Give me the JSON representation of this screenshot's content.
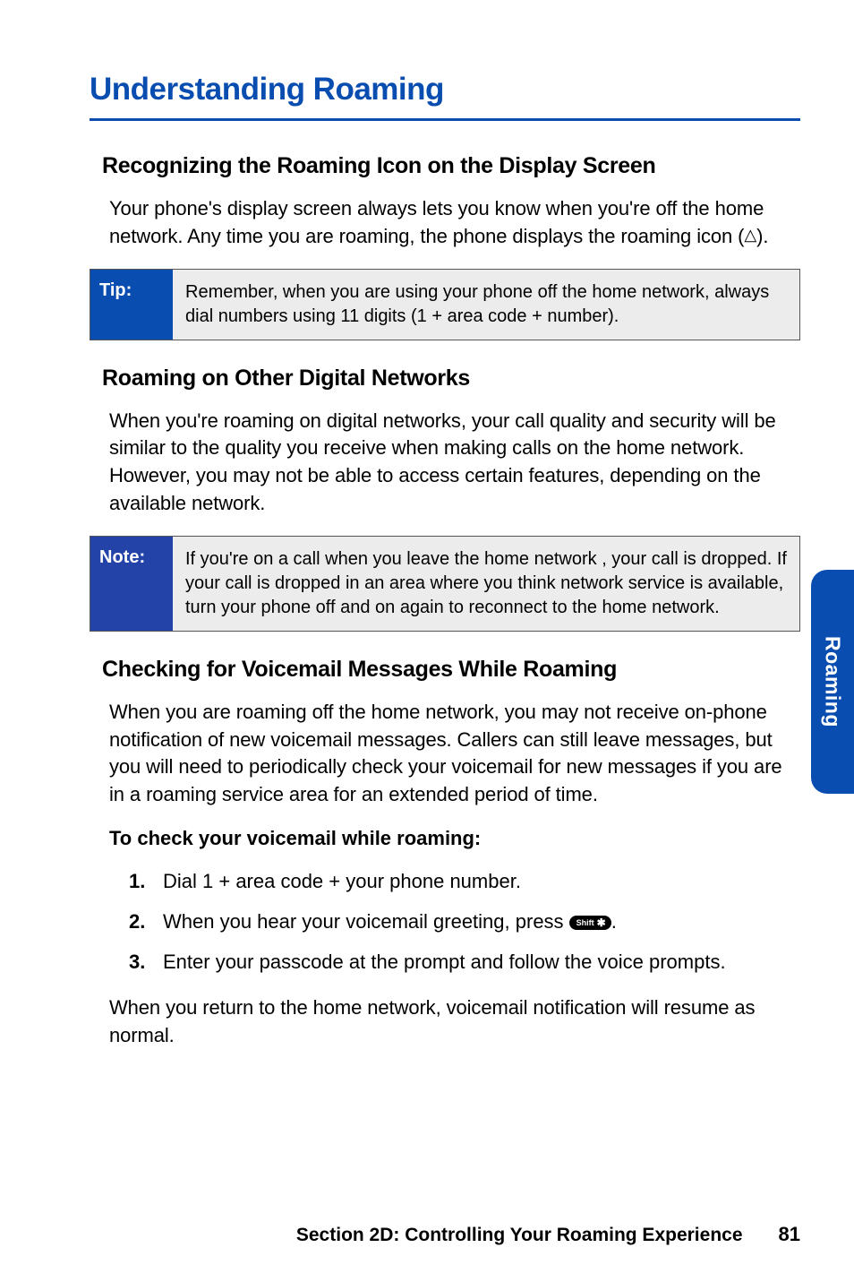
{
  "title": "Understanding Roaming",
  "tab": "Roaming",
  "sections": {
    "s1_title": "Recognizing the Roaming Icon on the Display Screen",
    "s1_body_a": "Your phone's display screen always lets you know when you're off the home network. Any time you are roaming, the phone displays the roaming icon (",
    "s1_body_b": ").",
    "s2_title": "Roaming on Other Digital Networks",
    "s2_body": "When you're roaming on digital networks, your call quality and security will be similar to the quality you receive when making calls on the home network. However, you may not be able to access certain features, depending on the available network.",
    "s3_title": "Checking for Voicemail Messages While Roaming",
    "s3_body": "When you are roaming off the home network, you may not receive on-phone notification of new voicemail messages. Callers can still leave messages, but you will need to periodically check your voicemail for new messages if you are in a roaming service area for an extended period of time.",
    "s3_sub": "To check your voicemail while roaming:",
    "s3_end": "When you return to the home network, voicemail notification will resume as normal."
  },
  "tip": {
    "label": "Tip:",
    "body": "Remember, when you are using your phone off the home network, always dial numbers using 11 digits (1 + area code + number)."
  },
  "note": {
    "label": "Note:",
    "body": "If you're on a call when you leave the home network , your call is dropped. If your call is dropped in an area where you think network service is available, turn your phone off and on again to reconnect to the home network."
  },
  "steps": {
    "n1": "1.",
    "t1": "Dial 1 + area code + your phone number.",
    "n2": "2.",
    "t2a": "When you hear your voicemail greeting, press ",
    "t2b": ".",
    "n3": "3.",
    "t3": "Enter your passcode at the prompt and follow the voice prompts."
  },
  "key": {
    "shift": "Shift",
    "x": "✱"
  },
  "icon": {
    "roam": "△"
  },
  "footer": {
    "section": "Section 2D: Controlling Your Roaming Experience",
    "page": "81"
  }
}
